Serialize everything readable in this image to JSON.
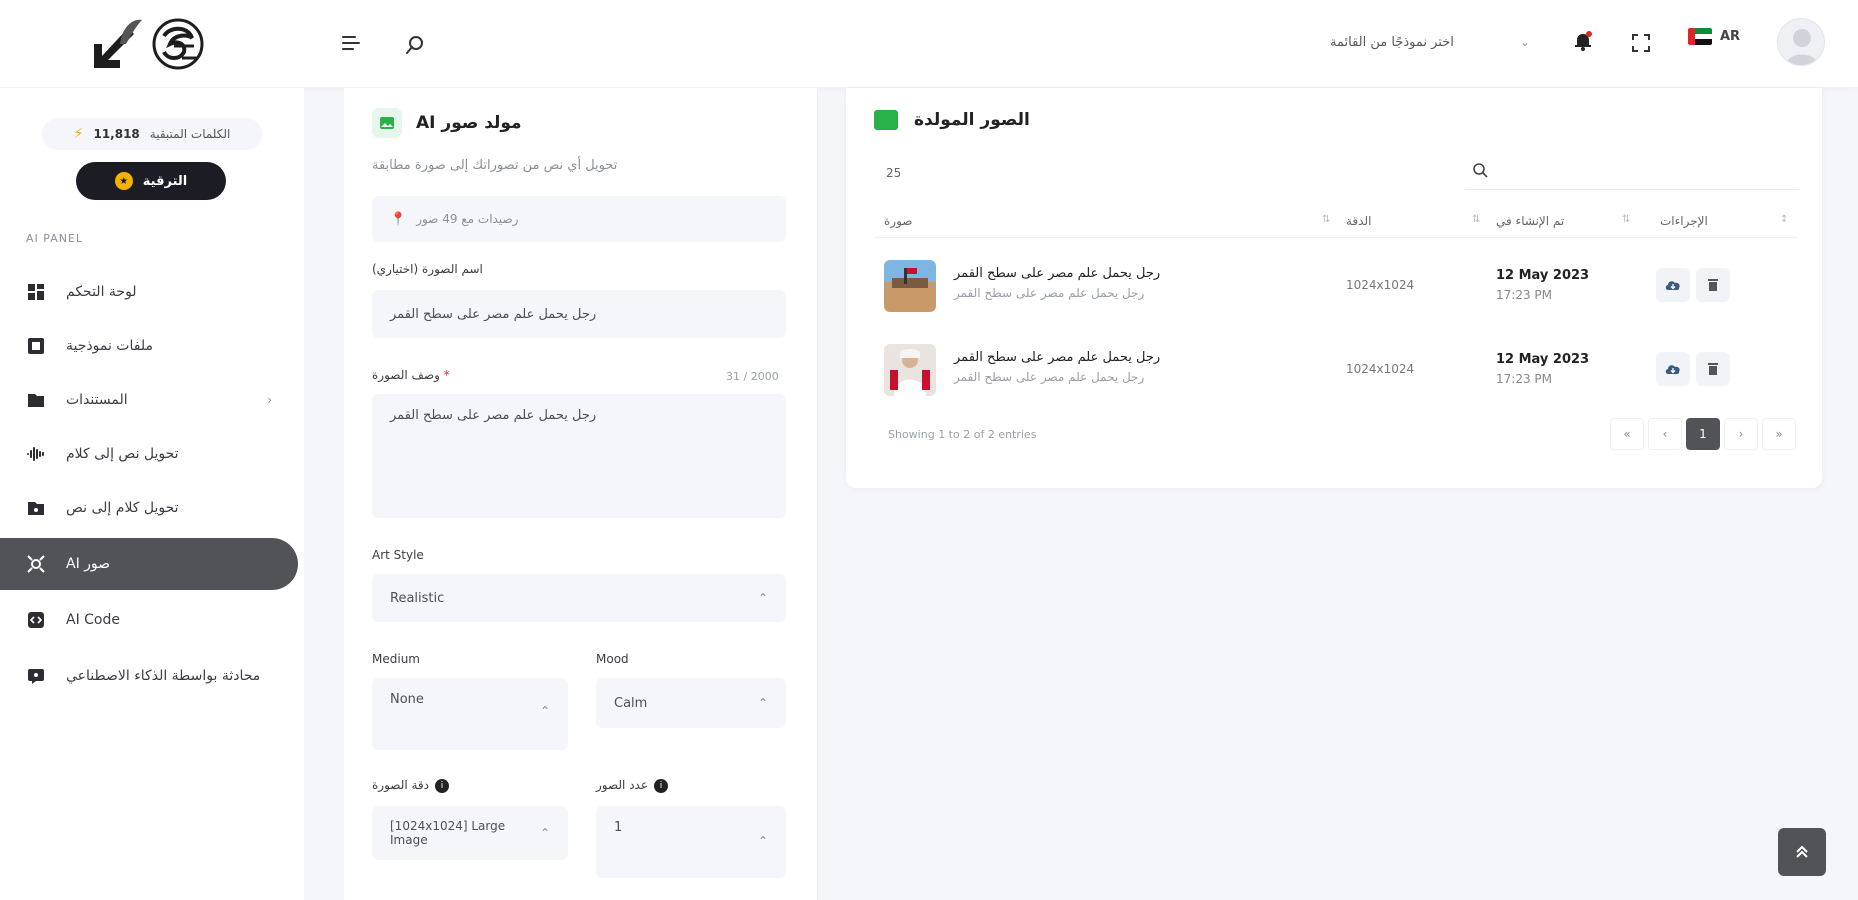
{
  "header": {
    "model_select_placeholder": "اختر نموذجًا من القائمة",
    "language": "AR",
    "icons": [
      "menu-icon",
      "search-icon",
      "bell-icon",
      "fullscreen-icon"
    ]
  },
  "sidebar": {
    "credits_label": "الكلمات المتبقية",
    "credits_value": "11,818",
    "upgrade_label": "الترقية",
    "section_label": "AI PANEL",
    "items": [
      {
        "label": "لوحة التحكم",
        "icon": "dashboard-icon"
      },
      {
        "label": "ملفات نموذجية",
        "icon": "templates-icon"
      },
      {
        "label": "المستندات",
        "icon": "documents-icon"
      },
      {
        "label": "تحويل نص إلى كلام",
        "icon": "voice-icon"
      },
      {
        "label": "تحويل كلام إلى نص",
        "icon": "speech-to-text-icon"
      },
      {
        "label": "AI صور",
        "icon": "ai-image-icon",
        "active": true
      },
      {
        "label": "AI Code",
        "icon": "code-icon"
      },
      {
        "label": "محادثة بواسطة الذكاء الاصطناعي",
        "icon": "chat-icon"
      }
    ]
  },
  "form": {
    "title": "AI مولد صور",
    "subtitle": "تحويل أي نص من تصوراتك إلى صورة مطابقة",
    "remaining_images": "رصيدات مع 49 صور",
    "name_label": "اسم الصورة (اختياري)",
    "name_value": "رجل يحمل علم مصر على سطح القمر",
    "desc_label": "وصف الصورة",
    "desc_counter": "31 / 2000",
    "desc_value": "رجل يحمل علم مصر على سطح القمر",
    "art_style_label": "Art Style",
    "art_style_value": "Realistic",
    "medium_label": "Medium",
    "medium_value": "None",
    "mood_label": "Mood",
    "mood_value": "Calm",
    "resolution_label": "دقة الصورة",
    "resolution_value": "[1024x1024] Large Image",
    "count_label": "عدد الصور",
    "count_value": "1"
  },
  "results": {
    "title": "الصور المولدة",
    "page_size": "25",
    "columns": {
      "image": "صورة",
      "resolution": "الدقة",
      "created": "تم الإنشاء في",
      "actions": "الإجراءات"
    },
    "rows": [
      {
        "title": "رجل يحمل علم مصر على سطح القمر",
        "desc": "رجل يحمل علم مصر على سطح القمر",
        "resolution": "1024x1024",
        "date": "12 May 2023",
        "time": "17:23 PM"
      },
      {
        "title": "رجل يحمل علم مصر على سطح القمر",
        "desc": "رجل يحمل علم مصر على سطح القمر",
        "resolution": "1024x1024",
        "date": "12 May 2023",
        "time": "17:23 PM"
      }
    ],
    "showing": "Showing 1 to 2 of 2 entries",
    "current_page": "1"
  }
}
